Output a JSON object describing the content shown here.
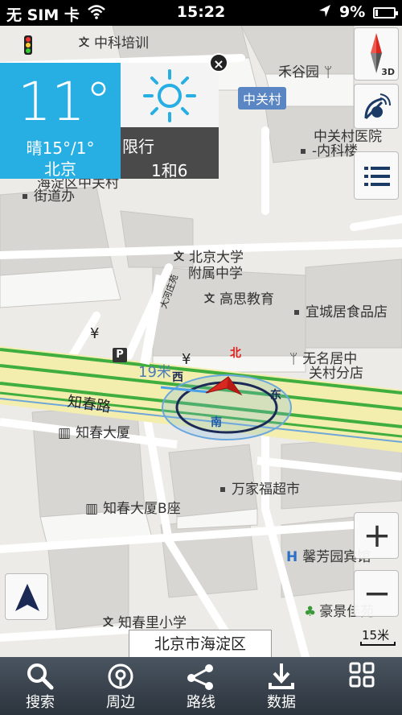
{
  "status_bar": {
    "carrier": "无 SIM 卡",
    "time": "15:22",
    "battery": "9%",
    "battery_level": 0.09
  },
  "weather": {
    "temperature": "11°",
    "condition": "晴15°/1°",
    "city": "北京",
    "restriction_label": "限行",
    "restriction_numbers": "1和6"
  },
  "map": {
    "station": "中关村",
    "pois": [
      {
        "id": "zhongke",
        "text": "中科培训",
        "marker": "文"
      },
      {
        "id": "heguyuan",
        "text": "禾谷园",
        "marker": "food"
      },
      {
        "id": "hospital-1",
        "text": "中关村医院",
        "marker": "dot"
      },
      {
        "id": "hospital-2",
        "text": "-内科楼"
      },
      {
        "id": "haidian-1",
        "text": "海淀区中关村"
      },
      {
        "id": "haidian-2",
        "text": "街道办"
      },
      {
        "id": "pku-1",
        "text": "北京大学",
        "marker": "文"
      },
      {
        "id": "pku-2",
        "text": "附属中学"
      },
      {
        "id": "gaosi",
        "text": "高思教育",
        "marker": "文"
      },
      {
        "id": "yicheng",
        "text": "宜城居食品店",
        "marker": "dot"
      },
      {
        "id": "wuming-1",
        "text": "无名居中",
        "marker": "food"
      },
      {
        "id": "wuming-2",
        "text": "关村分店"
      },
      {
        "id": "zhichun",
        "text": "知春大厦",
        "marker": "building"
      },
      {
        "id": "wanjia",
        "text": "万家福超市",
        "marker": "dot"
      },
      {
        "id": "zhichunb",
        "text": "知春大厦B座",
        "marker": "building"
      },
      {
        "id": "xinfang",
        "text": "馨芳园宾馆",
        "marker": "H"
      },
      {
        "id": "haojing",
        "text": "豪景佳苑",
        "marker": "park"
      },
      {
        "id": "zhichunli",
        "text": "知春里小学",
        "marker": "文"
      }
    ],
    "road_name": "知春路",
    "side_road": "大河庄苑",
    "compass_labels": {
      "north": "北",
      "south": "南",
      "east": "东",
      "west": "西"
    },
    "distance_label": "19米",
    "scale": "15米",
    "district": "北京市海淀区",
    "mode_3d": "3D"
  },
  "toolbar": {
    "items": [
      {
        "label": "搜索",
        "icon": "search-icon"
      },
      {
        "label": "周边",
        "icon": "nearby-icon"
      },
      {
        "label": "路线",
        "icon": "route-icon"
      },
      {
        "label": "数据",
        "icon": "download-icon"
      },
      {
        "label": "",
        "icon": "grid-icon"
      }
    ]
  },
  "colors": {
    "weather_blue": "#27aee3",
    "road_green": "#3fae3f",
    "road_yellow": "#f3eeae",
    "toolbar_dark": "#2c343d",
    "pointer_red": "#d9281f"
  }
}
